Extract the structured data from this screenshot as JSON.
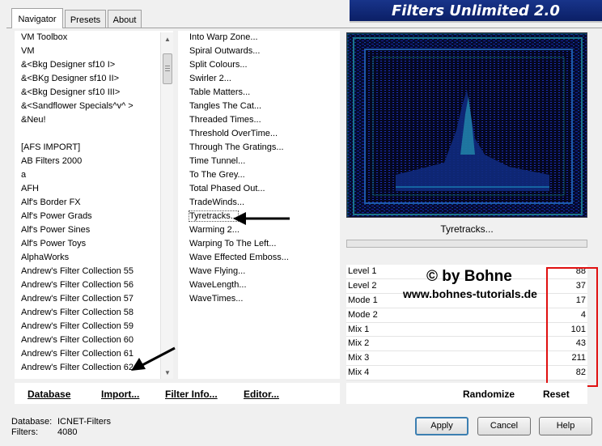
{
  "tabs": [
    {
      "label": "Navigator",
      "active": true
    },
    {
      "label": "Presets",
      "active": false
    },
    {
      "label": "About",
      "active": false
    }
  ],
  "banner": "Filters Unlimited 2.0",
  "categories": [
    "VM Toolbox",
    "VM",
    "&<Bkg Designer sf10 I>",
    "&<BKg Designer sf10 II>",
    "&<Bkg Designer sf10 III>",
    "&<Sandflower Specials^v^ >",
    "&Neu!",
    "",
    "[AFS IMPORT]",
    "AB Filters 2000",
    "a",
    "AFH",
    "Alf's Border FX",
    "Alf's Power Grads",
    "Alf's Power Sines",
    "Alf's Power Toys",
    "AlphaWorks",
    "Andrew's Filter Collection 55",
    "Andrew's Filter Collection 56",
    "Andrew's Filter Collection 57",
    "Andrew's Filter Collection 58",
    "Andrew's Filter Collection 59",
    "Andrew's Filter Collection 60",
    "Andrew's Filter Collection 61",
    "Andrew's Filter Collection 62"
  ],
  "selected_category": "Andrew's Filter Collection 62",
  "filters": [
    "Into Warp Zone...",
    "Spiral Outwards...",
    "Split Colours...",
    "Swirler 2...",
    "Table Matters...",
    "Tangles The Cat...",
    "Threaded Times...",
    "Threshold OverTime...",
    "Through The Gratings...",
    "Time Tunnel...",
    "To The Grey...",
    "Total Phased Out...",
    "TradeWinds...",
    "Tyretracks...",
    "Warming 2...",
    "Warping To The Left...",
    "Wave Effected Emboss...",
    "Wave Flying...",
    "WaveLength...",
    "WaveTimes..."
  ],
  "selected_filter": "Tyretracks...",
  "preview_label": "Tyretracks...",
  "watermark": {
    "line1": "© by Bohne",
    "line2": "www.bohnes-tutorials.de"
  },
  "params": [
    {
      "label": "Level 1",
      "value": "88"
    },
    {
      "label": "Level 2",
      "value": "37"
    },
    {
      "label": "Mode 1",
      "value": "17"
    },
    {
      "label": "Mode 2",
      "value": "4"
    },
    {
      "label": "Mix 1",
      "value": "101"
    },
    {
      "label": "Mix 2",
      "value": "43"
    },
    {
      "label": "Mix 3",
      "value": "211"
    },
    {
      "label": "Mix 4",
      "value": "82"
    }
  ],
  "lower_buttons": {
    "database": "Database",
    "import": "Import...",
    "filter_info": "Filter Info...",
    "editor": "Editor...",
    "randomize": "Randomize",
    "reset": "Reset"
  },
  "info": {
    "database_label": "Database:",
    "database_value": "ICNET-Filters",
    "filters_label": "Filters:",
    "filters_value": "4080"
  },
  "buttons": {
    "apply": "Apply",
    "cancel": "Cancel",
    "help": "Help"
  },
  "colors": {
    "banner": "#0b1f66",
    "highlight_box": "#e01010",
    "preview_bg": "#050826"
  }
}
